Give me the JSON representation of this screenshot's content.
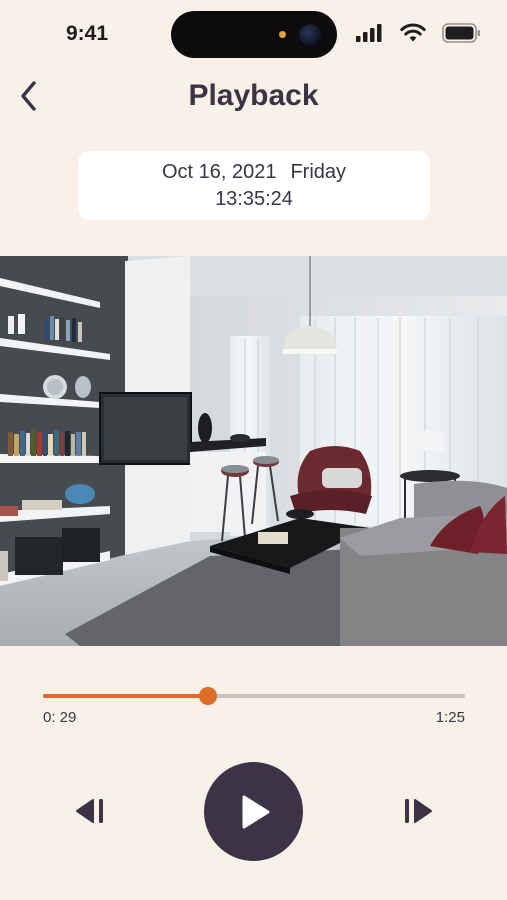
{
  "status_bar": {
    "time": "9:41",
    "icons": [
      "cellular-signal-icon",
      "wifi-icon",
      "battery-icon"
    ]
  },
  "header": {
    "title": "Playback",
    "back_icon": "chevron-left-icon"
  },
  "recording": {
    "date": "Oct 16, 2021",
    "weekday": "Friday",
    "time": "13:35:24"
  },
  "player": {
    "current_time": "0: 29",
    "total_time": "1:25",
    "progress_fraction": 0.39,
    "controls": [
      "skip-previous-icon",
      "play-icon",
      "skip-next-icon"
    ]
  },
  "colors": {
    "background": "#fbf0e8",
    "accent": "#e06a28",
    "primary_dark": "#3d3346",
    "track": "#c9c3c0"
  }
}
